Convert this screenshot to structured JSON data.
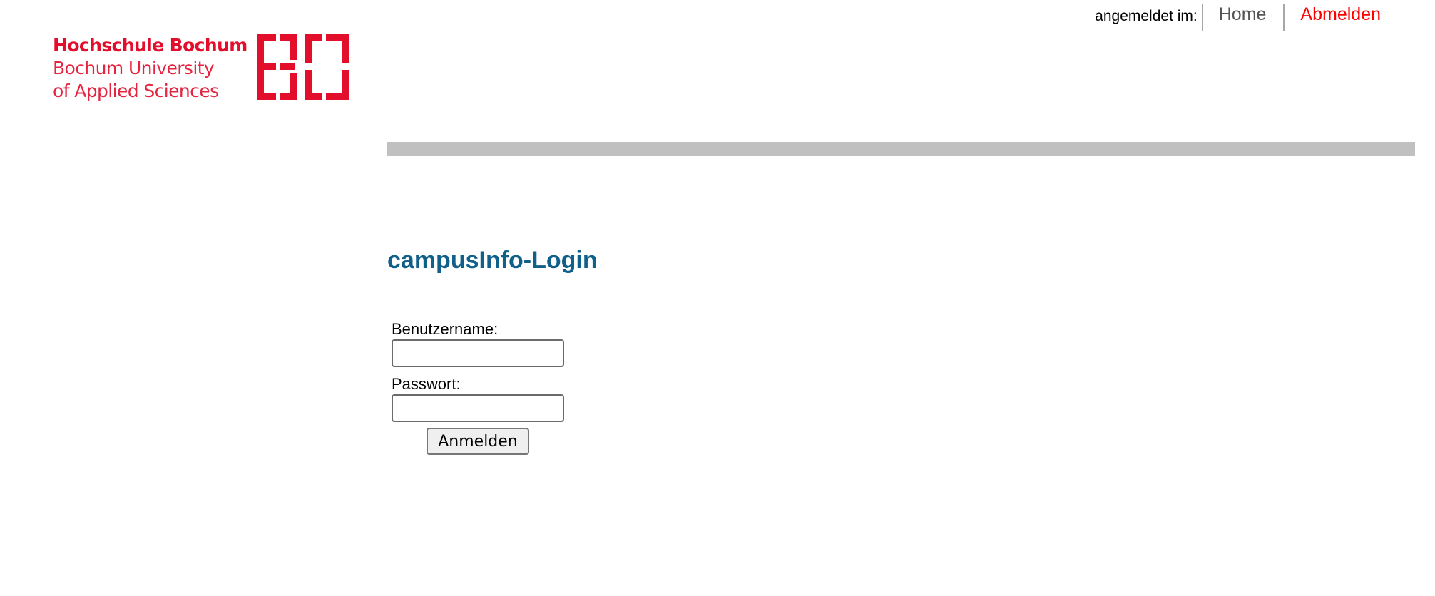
{
  "header": {
    "logged_in_label": "angemeldet im:",
    "nav": {
      "home": "Home",
      "logout": "Abmelden"
    }
  },
  "logo": {
    "line1": "Hochschule Bochum",
    "line2": "Bochum University",
    "line3": "of Applied Sciences",
    "mark_text": "BO",
    "color": "#e30d2c"
  },
  "main": {
    "title": "campusInfo-Login",
    "form": {
      "username_label": "Benutzername:",
      "username_value": "",
      "password_label": "Passwort:",
      "password_value": "",
      "submit_label": "Anmelden"
    }
  },
  "colors": {
    "title": "#11608a",
    "logout_link": "#ff0000",
    "home_link": "#555555",
    "bar": "#c0c0c0"
  }
}
